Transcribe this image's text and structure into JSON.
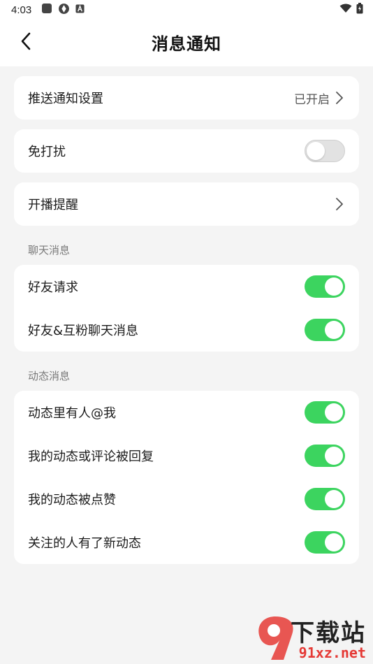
{
  "status_bar": {
    "time": "4:03",
    "icons": [
      "square-app-icon",
      "aperture-icon",
      "a-box-icon",
      "wifi-icon",
      "battery-icon"
    ]
  },
  "navbar": {
    "title": "消息通知",
    "back_icon": "chevron-left-icon"
  },
  "groups": {
    "push": {
      "label": "推送通知设置",
      "value": "已开启"
    },
    "dnd": {
      "label": "免打扰",
      "on": false
    },
    "live": {
      "label": "开播提醒"
    }
  },
  "chat_section": {
    "title": "聊天消息",
    "items": [
      {
        "label": "好友请求",
        "on": true
      },
      {
        "label": "好友&互粉聊天消息",
        "on": true
      }
    ]
  },
  "feed_section": {
    "title": "动态消息",
    "items": [
      {
        "label": "动态里有人@我",
        "on": true
      },
      {
        "label": "我的动态或评论被回复",
        "on": true
      },
      {
        "label": "我的动态被点赞",
        "on": true
      },
      {
        "label": "关注的人有了新动态",
        "on": true
      }
    ]
  },
  "watermark": {
    "top": "下载站",
    "bottom": "91xz.net"
  },
  "colors": {
    "toggle_on": "#3cd45f",
    "toggle_off": "#e2e2e2",
    "page_bg": "#f4f4f4",
    "card_bg": "#ffffff"
  }
}
